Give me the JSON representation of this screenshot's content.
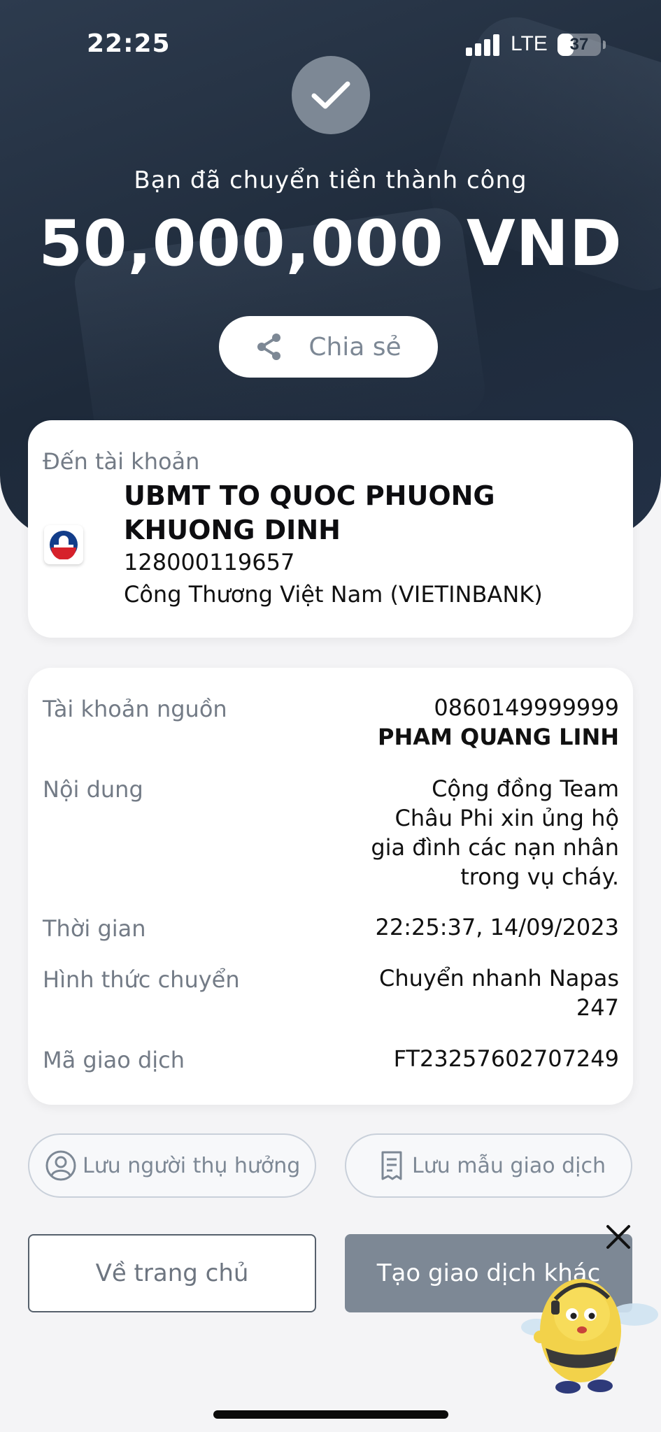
{
  "status_bar": {
    "time": "22:25",
    "network": "LTE",
    "battery": "37",
    "battery_level": 0.37
  },
  "header": {
    "success_message": "Bạn đã chuyển tiền thành công",
    "amount": "50,000,000 VND",
    "share_label": "Chia sẻ",
    "share_icon": "share-icon",
    "status_icon": "check-icon"
  },
  "recipient": {
    "section_label": "Đến tài khoản",
    "name": "UBMT TO QUOC PHUONG KHUONG DINH",
    "account_number": "128000119657",
    "bank": "Công Thương Việt Nam (VIETINBANK)",
    "bank_icon": "vietinbank-logo-icon"
  },
  "details": {
    "source_label": "Tài khoản nguồn",
    "source_account": "0860149999999",
    "source_name": "PHAM QUANG LINH",
    "content_label": "Nội dung",
    "content_lines": [
      "Cộng đồng Team",
      "Châu Phi xin ủng hộ",
      "gia đình các nạn nhân",
      "trong vụ cháy."
    ],
    "time_label": "Thời gian",
    "time_value": "22:25:37, 14/09/2023",
    "method_label": "Hình thức chuyển",
    "method_lines": [
      "Chuyển nhanh Napas",
      "247"
    ],
    "txn_label": "Mã giao dịch",
    "txn_value": "FT23257602707249"
  },
  "actions": {
    "save_beneficiary": "Lưu người thụ hưởng",
    "save_template": "Lưu mẫu giao dịch",
    "home": "Về trang chủ",
    "new_transaction": "Tạo giao dịch khác"
  },
  "colors": {
    "hero_bg": "#1e2a3a",
    "primary_button": "#7d8895",
    "card_bg": "#ffffff",
    "label_gray": "#737b86"
  }
}
